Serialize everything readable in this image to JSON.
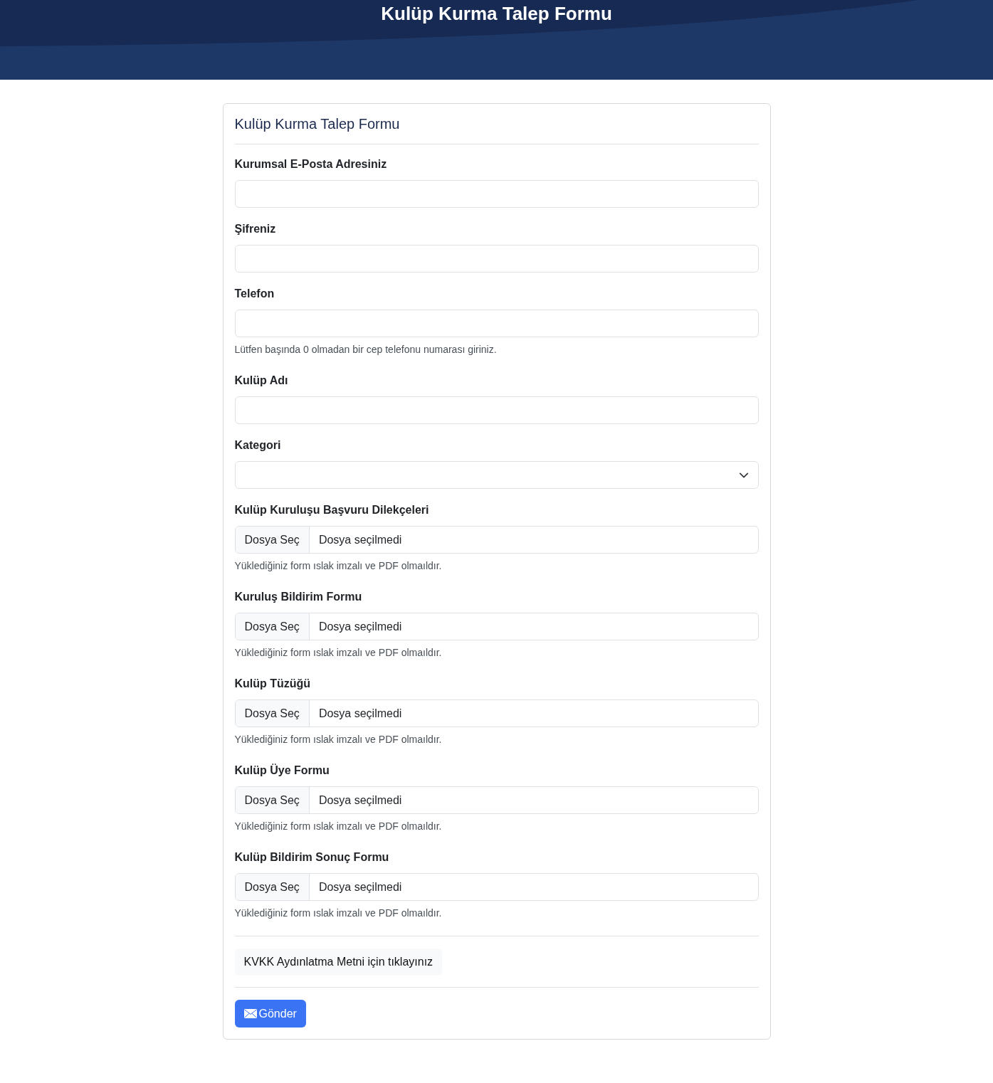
{
  "header": {
    "title": "Kulüp Kurma Talep Formu"
  },
  "form": {
    "title": "Kulüp Kurma Talep Formu",
    "fields": [
      {
        "kind": "text",
        "label": "Kurumsal E-Posta Adresiniz"
      },
      {
        "kind": "text",
        "label": "Şifreniz"
      },
      {
        "kind": "text",
        "label": "Telefon",
        "help": "Lütfen başında 0 olmadan bir cep telefonu numarası giriniz."
      },
      {
        "kind": "text",
        "label": "Kulüp Adı"
      },
      {
        "kind": "select",
        "label": "Kategori"
      },
      {
        "kind": "file",
        "label": "Kulüp Kuruluşu Başvuru Dilekçeleri",
        "button": "Dosya Seç",
        "value": "Dosya seçilmedi",
        "help": "Yüklediğiniz form ıslak imzalı ve PDF olmaıldır."
      },
      {
        "kind": "file",
        "label": "Kuruluş Bildirim Formu",
        "button": "Dosya Seç",
        "value": "Dosya seçilmedi",
        "help": "Yüklediğiniz form ıslak imzalı ve PDF olmaıldır."
      },
      {
        "kind": "file",
        "label": "Kulüp Tüzüğü",
        "button": "Dosya Seç",
        "value": "Dosya seçilmedi",
        "help": "Yüklediğiniz form ıslak imzalı ve PDF olmaıldır."
      },
      {
        "kind": "file",
        "label": "Kulüp Üye Formu",
        "button": "Dosya Seç",
        "value": "Dosya seçilmedi",
        "help": "Yüklediğiniz form ıslak imzalı ve PDF olmaıldır."
      },
      {
        "kind": "file",
        "label": "Kulüp Bildirim Sonuç Formu",
        "button": "Dosya Seç",
        "value": "Dosya seçilmedi",
        "help": "Yüklediğiniz form ıslak imzalı ve PDF olmaıldır."
      }
    ],
    "kvkk_link": "KVKK Aydınlatma Metni için tıklayınız",
    "submit": "Gönder"
  }
}
